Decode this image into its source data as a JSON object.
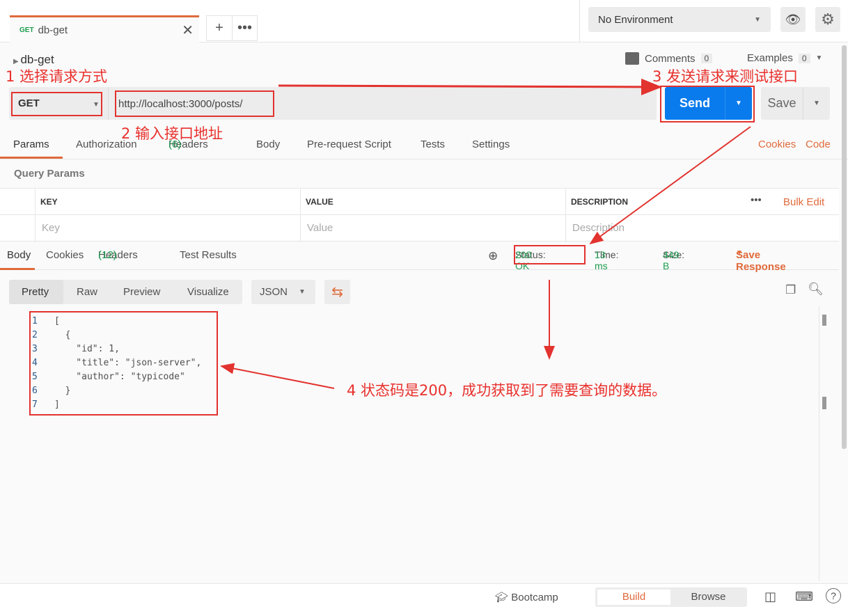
{
  "tab": {
    "method": "GET",
    "name": "db-get"
  },
  "environment": {
    "selected": "No Environment"
  },
  "request": {
    "name": "db-get",
    "comments_label": "Comments",
    "comments_count": "0",
    "examples_label": "Examples",
    "examples_count": "0",
    "method": "GET",
    "url": "http://localhost:3000/posts/",
    "send_label": "Send",
    "save_label": "Save"
  },
  "request_tabs": [
    "Params",
    "Authorization",
    "Headers",
    "Body",
    "Pre-request Script",
    "Tests",
    "Settings"
  ],
  "headers_count": "(6)",
  "cookies_link": "Cookies",
  "code_link": "Code",
  "query_params": {
    "title": "Query Params",
    "columns": [
      "KEY",
      "VALUE",
      "DESCRIPTION"
    ],
    "bulk_edit": "Bulk Edit",
    "placeholders": [
      "Key",
      "Value",
      "Description"
    ]
  },
  "response": {
    "tabs": [
      "Body",
      "Cookies",
      "Headers",
      "Test Results"
    ],
    "headers_count": "(12)",
    "status_label": "Status:",
    "status": "200 OK",
    "time_label": "Time:",
    "time": "13 ms",
    "size_label": "Size:",
    "size": "449 B",
    "save_response": "Save Response",
    "views": [
      "Pretty",
      "Raw",
      "Preview",
      "Visualize"
    ],
    "format": "JSON",
    "lines": [
      [
        "1",
        "["
      ],
      [
        "2",
        "  {"
      ],
      [
        "3",
        "    \"id\": 1,"
      ],
      [
        "4",
        "    \"title\": \"json-server\","
      ],
      [
        "5",
        "    \"author\": \"typicode\""
      ],
      [
        "6",
        "  }"
      ],
      [
        "7",
        "]"
      ]
    ]
  },
  "footer": {
    "bootcamp": "Bootcamp",
    "build": "Build",
    "browse": "Browse"
  },
  "annotations": {
    "a1": "1 选择请求方式",
    "a2": "2 输入接口地址",
    "a3": "3 发送请求来测试接口",
    "a4": "4 状态码是200，成功获取到了需要查询的数据。"
  },
  "colors": {
    "accent": "#e06a3b",
    "send": "#097bed",
    "success": "#1e9e4f",
    "annotation": "#e2332f"
  }
}
